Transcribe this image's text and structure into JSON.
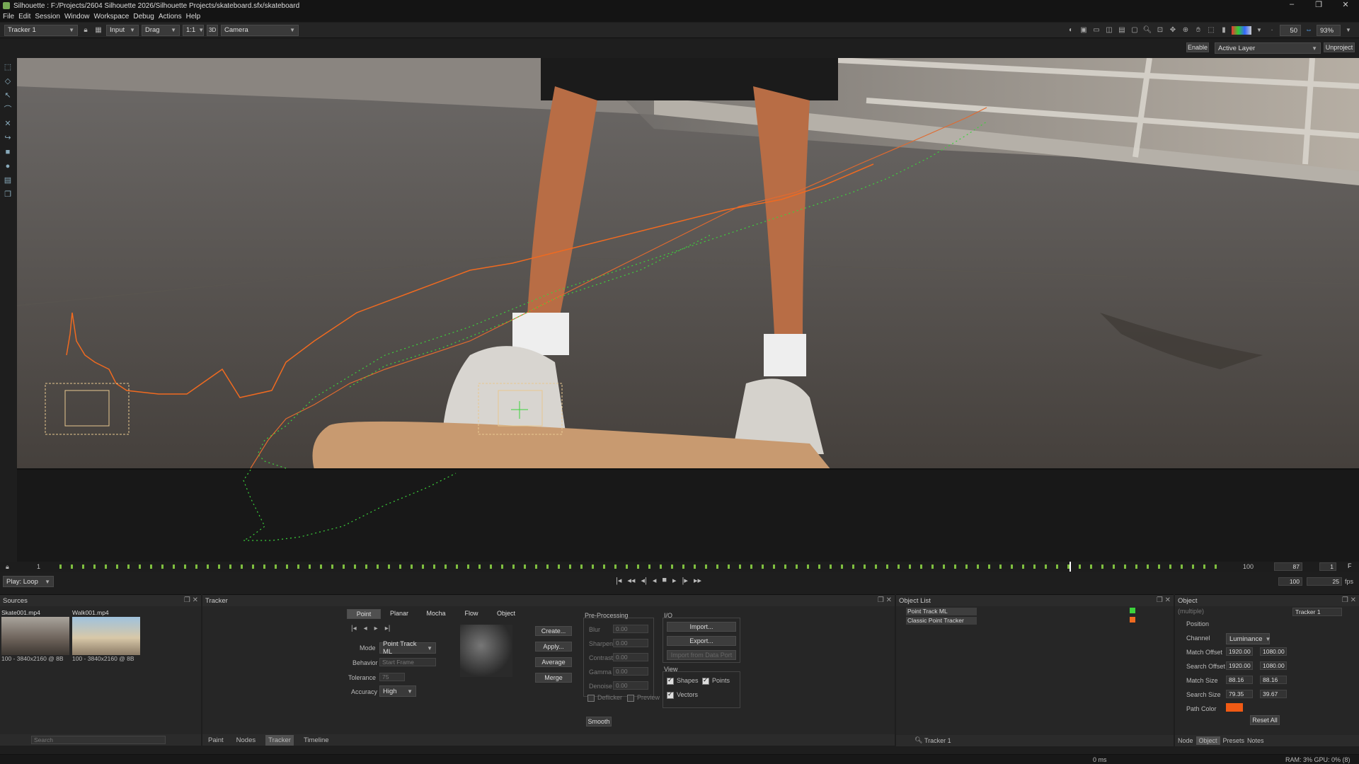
{
  "window": {
    "title": "Silhouette : F:/Projects/2604 Silhouette 2026/Silhouette Projects/skateboard.sfx/skateboard",
    "controls": [
      "–",
      "❐",
      "✕"
    ]
  },
  "menu": [
    "File",
    "Edit",
    "Session",
    "Window",
    "Workspace",
    "Debug",
    "Actions",
    "Help"
  ],
  "toolbar": {
    "node": "Tracker 1",
    "view": "Input",
    "drag_mode": "Drag",
    "ratio": "1:1",
    "threed": "3D",
    "camera": "Camera",
    "field_50": "50",
    "zoom": "93%"
  },
  "viewer_header": {
    "enable": "Enable",
    "active_layer": "Active Layer",
    "unproject": "Unproject"
  },
  "timeline": {
    "start": "1",
    "end": "100",
    "current": "87",
    "current_fraction": 0.87,
    "field_right": "1",
    "playmode": "Play: Loop",
    "out": "100",
    "fps": "25",
    "fps_label": "fps"
  },
  "sources": {
    "title": "Sources",
    "items": [
      {
        "name": "Skate001.mp4",
        "info": "100 - 3840x2160 @ 8B"
      },
      {
        "name": "Walk001.mp4",
        "info": "100 - 3840x2160 @ 8B"
      }
    ],
    "search_placeholder": "Search"
  },
  "bottom_tabs_left": [
    "Paint",
    "Nodes",
    "Tracker",
    "Timeline"
  ],
  "tracker": {
    "title": "Tracker",
    "tabs": [
      "Point",
      "Planar",
      "Mocha",
      "Flow",
      "Object"
    ],
    "mode_label": "Mode",
    "mode": "Point Track ML",
    "behavior_label": "Behavior",
    "behavior": "Start Frame",
    "tolerance_label": "Tolerance",
    "tolerance": "75",
    "accuracy_label": "Accuracy",
    "accuracy": "High",
    "buttons": [
      "Create...",
      "Apply...",
      "Average",
      "Merge"
    ],
    "preprocessing": {
      "title": "Pre-Processing",
      "rows": [
        {
          "label": "Blur",
          "value": "0.00"
        },
        {
          "label": "Sharpen",
          "value": "0.00"
        },
        {
          "label": "Contrast",
          "value": "0.00"
        },
        {
          "label": "Gamma",
          "value": "0.00"
        },
        {
          "label": "Denoise",
          "value": "0.00"
        }
      ],
      "deflicker": "Deflicker",
      "preview": "Preview",
      "smooth": "Smooth"
    },
    "io": {
      "title": "I/O",
      "import": "Import...",
      "export": "Export...",
      "import_data": "Import from Data Port"
    },
    "view": {
      "title": "View",
      "shapes": "Shapes",
      "points": "Points",
      "vectors": "Vectors"
    }
  },
  "object_list": {
    "title": "Object List",
    "items": [
      "Point Track ML",
      "Classic Point Tracker"
    ],
    "footer": "Tracker 1"
  },
  "object": {
    "title": "Object",
    "multiple": "(multiple)",
    "name": "Tracker 1",
    "position_label": "Position",
    "channel_label": "Channel",
    "channel": "Luminance",
    "match_offset_label": "Match Offset",
    "match_offset": [
      "1920.00",
      "1080.00"
    ],
    "search_offset_label": "Search Offset",
    "search_offset": [
      "1920.00",
      "1080.00"
    ],
    "match_size_label": "Match Size",
    "match_size": [
      "88.16",
      "88.16"
    ],
    "search_size_label": "Search Size",
    "search_size": [
      "79.35",
      "39.67"
    ],
    "path_color_label": "Path Color",
    "path_color": "#f05a14",
    "reset": "Reset All",
    "tabs": [
      "Node",
      "Object",
      "Presets",
      "Notes"
    ]
  },
  "status": {
    "time": "0 ms",
    "ram": "RAM: 3% GPU: 0% (8)"
  },
  "colors": {
    "accent": "#f05a14",
    "track_green": "#3cd23c",
    "track_orange": "#f06a20"
  }
}
